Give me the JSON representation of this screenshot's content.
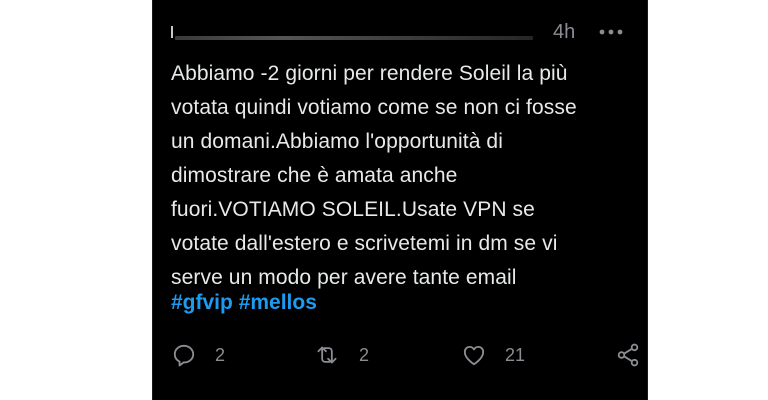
{
  "tweet": {
    "timestamp": "4h",
    "text_lines": [
      "Abbiamo -2 giorni per rendere Soleil la più",
      "votata quindi votiamo come se non ci fosse",
      "un domani.Abbiamo l'opportunità di",
      "dimostrare che è amata anche",
      "fuori.VOTIAMO SOLEIL.Usate VPN se",
      "votate dall'estero e scrivetemi in dm se vi",
      "serve un modo per avere tante email"
    ],
    "hashtags": [
      "#gfvip",
      "#mellos"
    ]
  },
  "actions": {
    "reply": {
      "icon": "reply-icon",
      "count": "2"
    },
    "retweet": {
      "icon": "retweet-icon",
      "count": "2"
    },
    "like": {
      "icon": "heart-icon",
      "count": "21"
    },
    "share": {
      "icon": "share-icon"
    }
  },
  "colors": {
    "background": "#000000",
    "text": "#e7e9ea",
    "muted": "#8a8d91",
    "hashtag": "#1d9bf0"
  }
}
